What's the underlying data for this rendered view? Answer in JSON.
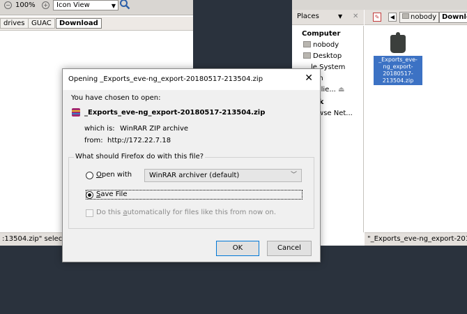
{
  "left_window": {
    "zoom_label": "100%",
    "view_select": "Icon View",
    "crumbs": [
      "drives",
      "GUAC",
      "Download"
    ],
    "status_text": ":13504.zip\" selecte"
  },
  "right_window": {
    "places_label": "Places",
    "places": {
      "computer_heading": "Computer",
      "nobody": "nobody",
      "desktop": "Desktop",
      "filesystem": "le System",
      "trash": "ash",
      "incliep": "inclie...",
      "network_heading": "ork",
      "browse_net": "rowse Net..."
    },
    "crumb_nobody": "nobody",
    "crumb_download": "Downlo",
    "file_label": "_Exports_eve-ng_export-20180517-213504.zip",
    "status_text": "\"_Exports_eve-ng_export-20180"
  },
  "dialog": {
    "title": "Opening _Exports_eve-ng_export-20180517-213504.zip",
    "intro": "You have chosen to open:",
    "filename": "_Exports_eve-ng_export-20180517-213504.zip",
    "which_is_label": "which is:",
    "which_is_value": "WinRAR ZIP archive",
    "from_label": "from:",
    "from_value": "http://172.22.7.18",
    "question": "What should Firefox do with this file?",
    "open_with_prefix": "O",
    "open_with_rest": "pen with",
    "app_select": "WinRAR archiver (default)",
    "save_file_prefix": "S",
    "save_file_rest": "ave File",
    "auto_part1": "Do this ",
    "auto_accel": "a",
    "auto_part2": "utomatically for files like this from now on.",
    "ok_label": "OK",
    "cancel_label": "Cancel"
  }
}
